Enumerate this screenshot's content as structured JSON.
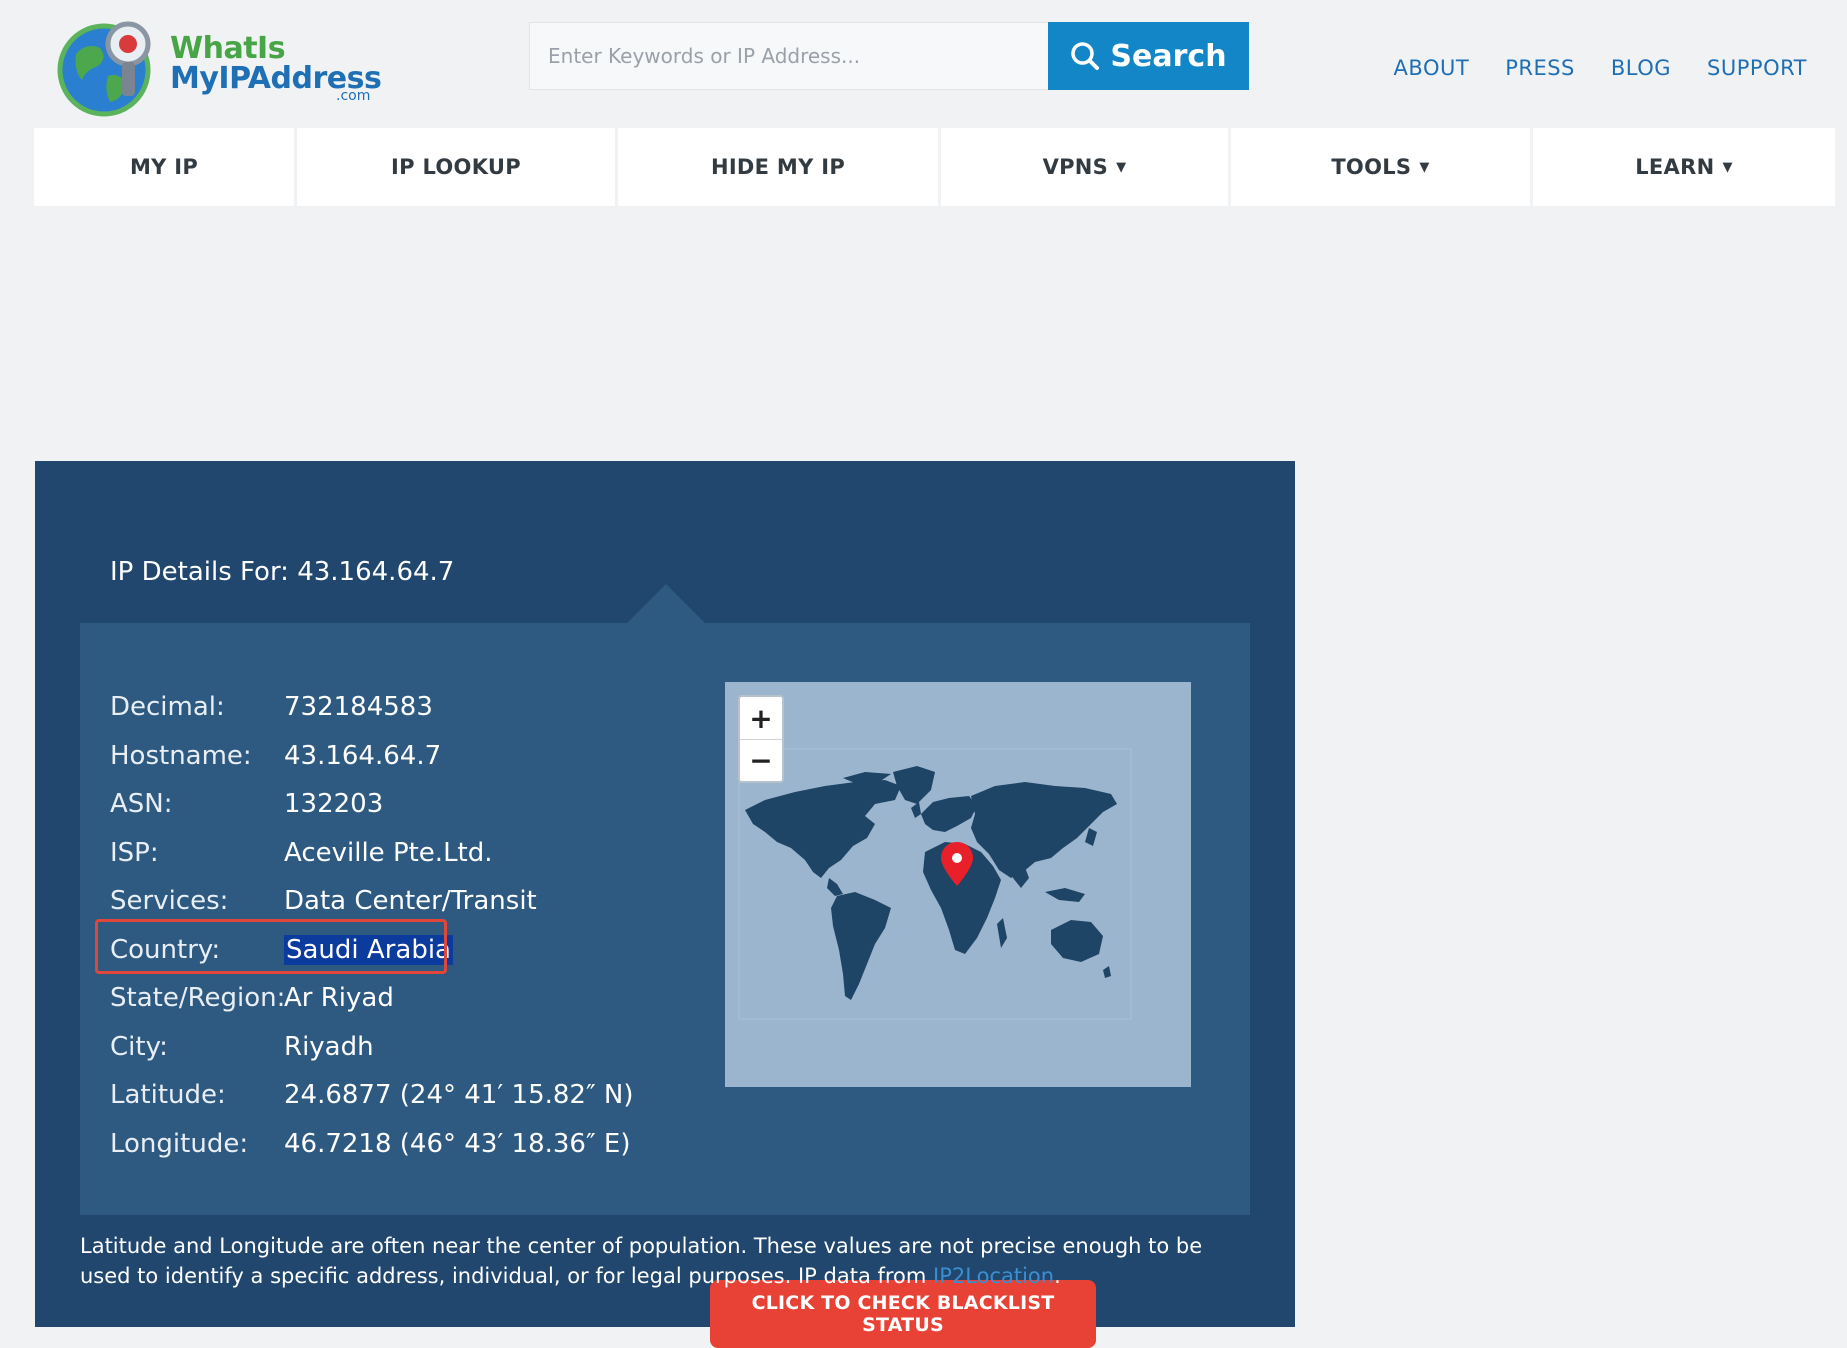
{
  "header": {
    "logo": {
      "line1": "WhatIs",
      "line2": "MyIPAddress",
      "suffix": ".com"
    },
    "search": {
      "placeholder": "Enter Keywords or IP Address...",
      "button_label": "Search"
    },
    "top_links": [
      "ABOUT",
      "PRESS",
      "BLOG",
      "SUPPORT"
    ]
  },
  "nav": {
    "items": [
      {
        "label": "MY IP",
        "dropdown": false
      },
      {
        "label": "IP LOOKUP",
        "dropdown": false
      },
      {
        "label": "HIDE MY IP",
        "dropdown": false
      },
      {
        "label": "VPNS",
        "dropdown": true
      },
      {
        "label": "TOOLS",
        "dropdown": true
      },
      {
        "label": "LEARN",
        "dropdown": true
      }
    ],
    "caret": "▼"
  },
  "details": {
    "title": "IP Details For: 43.164.64.7",
    "rows": [
      {
        "label": "Decimal:",
        "value": "732184583"
      },
      {
        "label": "Hostname:",
        "value": "43.164.64.7"
      },
      {
        "label": "ASN:",
        "value": "132203"
      },
      {
        "label": "ISP:",
        "value": "Aceville Pte.Ltd."
      },
      {
        "label": "Services:",
        "value": "Data Center/Transit"
      },
      {
        "label": "Country:",
        "value": "Saudi Arabia"
      },
      {
        "label": "State/Region:",
        "value": "Ar Riyad"
      },
      {
        "label": "City:",
        "value": "Riyadh"
      },
      {
        "label": "Latitude:",
        "value": "24.6877 (24° 41′ 15.82″ N)"
      },
      {
        "label": "Longitude:",
        "value": "46.7218 (46° 43′ 18.36″ E)"
      }
    ],
    "selected_row": "Country:",
    "map": {
      "zoom_in": "+",
      "zoom_out": "−",
      "marker_color": "#e8202a"
    },
    "blacklist_button": "CLICK TO CHECK BLACKLIST STATUS",
    "footnote": {
      "text": "Latitude and Longitude are often near the center of population. These values are not precise enough to be used to identify a specific address, individual, or for legal purposes. IP data from ",
      "link": "IP2Location",
      "end": "."
    }
  },
  "colors": {
    "page_bg": "#f1f2f3",
    "brand_blue": "#1286c7",
    "panel_bg": "#21476e",
    "inner_bg": "#2e5a82",
    "map_bg": "#9cb5cf",
    "land": "#1e4466",
    "button_red": "#e84135",
    "highlight_border": "#e0473a"
  }
}
